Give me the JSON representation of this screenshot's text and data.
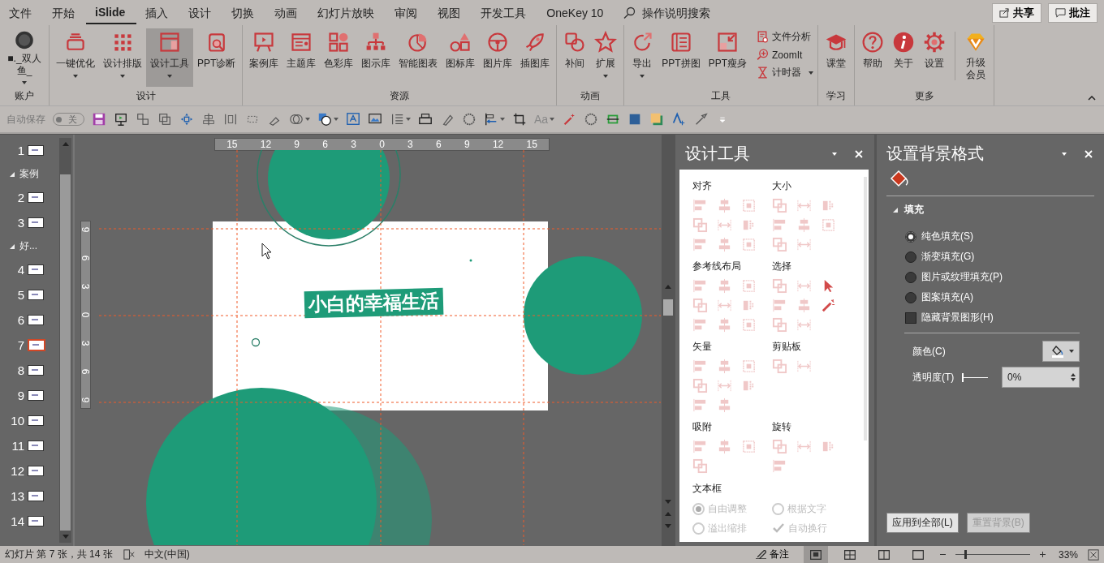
{
  "menu_tabs": [
    {
      "label": "文件",
      "selected": false
    },
    {
      "label": "开始",
      "selected": false
    },
    {
      "label": "iSlide",
      "selected": true
    },
    {
      "label": "插入",
      "selected": false
    },
    {
      "label": "设计",
      "selected": false
    },
    {
      "label": "切换",
      "selected": false
    },
    {
      "label": "动画",
      "selected": false
    },
    {
      "label": "幻灯片放映",
      "selected": false
    },
    {
      "label": "审阅",
      "selected": false
    },
    {
      "label": "视图",
      "selected": false
    },
    {
      "label": "开发工具",
      "selected": false
    },
    {
      "label": "OneKey 10",
      "selected": false
    }
  ],
  "search": {
    "placeholder": "操作说明搜索"
  },
  "share_button": "共享",
  "comments_button": "批注",
  "ribbon_groups": [
    {
      "label": "账户",
      "buttons": [
        {
          "kind": "account",
          "label": "■._双人鱼_",
          "dropdown": true,
          "pressed": false
        }
      ]
    },
    {
      "label": "设计",
      "buttons": [
        {
          "kind": "large",
          "label": "一键优化",
          "dropdown": true,
          "pressed": false
        },
        {
          "kind": "large",
          "label": "设计排版",
          "dropdown": true,
          "pressed": false
        },
        {
          "kind": "large",
          "label": "设计工具",
          "dropdown": true,
          "pressed": true
        },
        {
          "kind": "large",
          "label": "PPT诊断",
          "dropdown": false,
          "pressed": false
        }
      ]
    },
    {
      "label": "资源",
      "buttons": [
        {
          "kind": "large",
          "label": "案例库",
          "dropdown": false,
          "pressed": false
        },
        {
          "kind": "large",
          "label": "主题库",
          "dropdown": false,
          "pressed": false
        },
        {
          "kind": "large",
          "label": "色彩库",
          "dropdown": false,
          "pressed": false
        },
        {
          "kind": "large",
          "label": "图示库",
          "dropdown": false,
          "pressed": false
        },
        {
          "kind": "large",
          "label": "智能图表",
          "dropdown": false,
          "pressed": false
        },
        {
          "kind": "large",
          "label": "图标库",
          "dropdown": false,
          "pressed": false
        },
        {
          "kind": "large",
          "label": "图片库",
          "dropdown": false,
          "pressed": false
        },
        {
          "kind": "large",
          "label": "插图库",
          "dropdown": false,
          "pressed": false
        }
      ]
    },
    {
      "label": "动画",
      "buttons": [
        {
          "kind": "large",
          "label": "补间",
          "dropdown": false,
          "pressed": false
        },
        {
          "kind": "large",
          "label": "扩展",
          "dropdown": true,
          "pressed": false
        }
      ]
    },
    {
      "label": "工具",
      "buttons": [
        {
          "kind": "large",
          "label": "导出",
          "dropdown": true,
          "pressed": false
        },
        {
          "kind": "large",
          "label": "PPT拼图",
          "dropdown": false,
          "pressed": false
        },
        {
          "kind": "large",
          "label": "PPT瘦身",
          "dropdown": false,
          "pressed": false
        },
        {
          "kind": "small",
          "label": "文件分析",
          "dropdown": false,
          "pressed": false
        },
        {
          "kind": "small",
          "label": "ZoomIt",
          "dropdown": false,
          "pressed": false
        },
        {
          "kind": "small",
          "label": "计时器",
          "dropdown": true,
          "pressed": false
        }
      ]
    },
    {
      "label": "学习",
      "buttons": [
        {
          "kind": "large",
          "label": "课堂",
          "dropdown": false,
          "pressed": false
        }
      ]
    },
    {
      "label": "更多",
      "buttons": [
        {
          "kind": "large",
          "label": "帮助",
          "dropdown": false,
          "pressed": false
        },
        {
          "kind": "large",
          "label": "关于",
          "dropdown": false,
          "pressed": false
        },
        {
          "kind": "large",
          "label": "设置",
          "dropdown": false,
          "pressed": false
        },
        {
          "kind": "upgrade",
          "label": "升级会员",
          "dropdown": false,
          "pressed": false
        }
      ]
    }
  ],
  "quick_toolbar": {
    "autosave_label": "自动保存",
    "toggle_label": "关",
    "autosave_on": false,
    "case_button": "Aa"
  },
  "slides": [
    {
      "kind": "slide",
      "number": "1",
      "selected": false
    },
    {
      "kind": "section",
      "title": "案例",
      "expanded": true
    },
    {
      "kind": "slide",
      "number": "2",
      "selected": false
    },
    {
      "kind": "slide",
      "number": "3",
      "selected": false
    },
    {
      "kind": "section",
      "title": "好...",
      "expanded": true
    },
    {
      "kind": "slide",
      "number": "4",
      "selected": false
    },
    {
      "kind": "slide",
      "number": "5",
      "selected": false
    },
    {
      "kind": "slide",
      "number": "6",
      "selected": false
    },
    {
      "kind": "slide",
      "number": "7",
      "selected": true
    },
    {
      "kind": "slide",
      "number": "8",
      "selected": false
    },
    {
      "kind": "slide",
      "number": "9",
      "selected": false
    },
    {
      "kind": "slide",
      "number": "10",
      "selected": false
    },
    {
      "kind": "slide",
      "number": "11",
      "selected": false
    },
    {
      "kind": "slide",
      "number": "12",
      "selected": false
    },
    {
      "kind": "slide",
      "number": "13",
      "selected": false
    },
    {
      "kind": "slide",
      "number": "14",
      "selected": false
    }
  ],
  "editor": {
    "ruler_h": [
      "15",
      "12",
      "9",
      "6",
      "3",
      "0",
      "3",
      "6",
      "9",
      "12",
      "15"
    ],
    "ruler_v": [
      "9",
      "6",
      "3",
      "0",
      "3",
      "6",
      "9"
    ],
    "slide_title": "小白的幸福生活"
  },
  "design_tools": {
    "title": "设计工具",
    "sections": [
      {
        "title": "对齐",
        "tools": [
          {
            "disabled": true
          },
          {
            "disabled": true
          },
          {
            "disabled": true
          },
          {
            "disabled": true
          },
          {
            "disabled": true
          },
          {
            "disabled": true
          },
          {
            "disabled": true
          },
          {
            "disabled": true
          },
          {
            "disabled": true
          }
        ]
      },
      {
        "title": "大小",
        "tools": [
          {
            "disabled": true
          },
          {
            "disabled": true
          },
          {
            "disabled": true
          },
          {
            "disabled": true
          },
          {
            "disabled": true
          },
          {
            "disabled": true
          },
          {
            "disabled": true
          },
          {
            "disabled": true
          }
        ]
      },
      {
        "title": "参考线布局",
        "tools": [
          {
            "disabled": true
          },
          {
            "disabled": true
          },
          {
            "disabled": true
          },
          {
            "disabled": true
          },
          {
            "disabled": true
          },
          {
            "disabled": true
          },
          {
            "disabled": true
          },
          {
            "disabled": true
          },
          {
            "disabled": true
          }
        ]
      },
      {
        "title": "选择",
        "tools": [
          {
            "disabled": true
          },
          {
            "disabled": true
          },
          {
            "disabled": false
          },
          {
            "disabled": true
          },
          {
            "disabled": true
          },
          {
            "disabled": false
          },
          {
            "disabled": true
          },
          {
            "disabled": true
          }
        ]
      },
      {
        "title": "矢量",
        "tools": [
          {
            "disabled": true
          },
          {
            "disabled": true
          },
          {
            "disabled": true
          },
          {
            "disabled": true
          },
          {
            "disabled": true
          },
          {
            "disabled": true
          },
          {
            "disabled": true
          },
          {
            "disabled": true
          }
        ]
      },
      {
        "title": "剪贴板",
        "tools": [
          {
            "disabled": true
          },
          {
            "disabled": true
          }
        ]
      },
      {
        "title": "吸附",
        "tools": [
          {
            "disabled": true
          },
          {
            "disabled": true
          },
          {
            "disabled": true
          },
          {
            "disabled": true
          }
        ]
      },
      {
        "title": "旋转",
        "tools": [
          {
            "disabled": true
          },
          {
            "disabled": true
          },
          {
            "disabled": true
          },
          {
            "disabled": true
          }
        ]
      }
    ],
    "textbox": {
      "title": "文本框",
      "options": [
        {
          "kind": "radio",
          "label": "自由调整",
          "selected": true,
          "disabled": true
        },
        {
          "kind": "radio",
          "label": "根据文字",
          "selected": false,
          "disabled": true
        },
        {
          "kind": "radio",
          "label": "溢出缩排",
          "selected": false,
          "disabled": true
        },
        {
          "kind": "checkbox",
          "label": "自动换行",
          "checked": true,
          "disabled": true
        }
      ]
    }
  },
  "format_panel": {
    "title": "设置背景格式",
    "section": {
      "title": "填充",
      "expanded": true
    },
    "fill_options": [
      {
        "label": "纯色填充(S)",
        "selected": true
      },
      {
        "label": "渐变填充(G)",
        "selected": false
      },
      {
        "label": "图片或纹理填充(P)",
        "selected": false
      },
      {
        "label": "图案填充(A)",
        "selected": false
      }
    ],
    "hide_background": {
      "label": "隐藏背景图形(H)",
      "checked": false
    },
    "color_label": "颜色(C)",
    "transparency": {
      "label": "透明度(T)",
      "level": 0,
      "value": "0%"
    },
    "buttons": [
      {
        "label": "应用到全部(L)",
        "disabled": false
      },
      {
        "label": "重置背景(B)",
        "disabled": true
      }
    ]
  },
  "status_bar": {
    "slide_info": "幻灯片 第 7 张，共 14 张",
    "language": "中文(中国)",
    "notes": "备注",
    "views": [
      {
        "selected": true
      },
      {
        "selected": false
      },
      {
        "selected": false
      },
      {
        "selected": false
      }
    ],
    "zoom": {
      "level": 0.12,
      "value": "33%"
    }
  }
}
